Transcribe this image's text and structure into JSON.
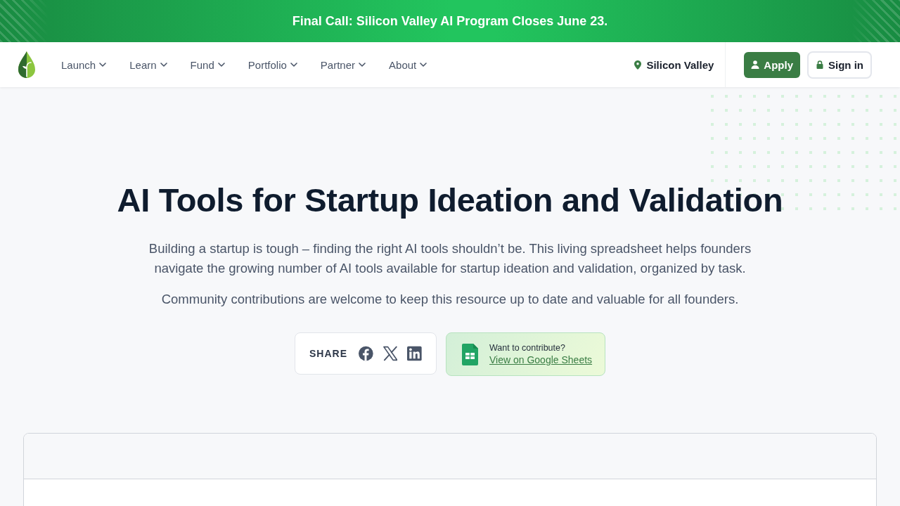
{
  "announcement_bar": {
    "text": "Final Call: Silicon Valley AI Program Closes June 23."
  },
  "nav": {
    "items": [
      {
        "label": "Launch"
      },
      {
        "label": "Learn"
      },
      {
        "label": "Fund"
      },
      {
        "label": "Portfolio"
      },
      {
        "label": "Partner"
      },
      {
        "label": "About"
      }
    ],
    "location": "Silicon Valley",
    "apply_button": {
      "label": "Apply"
    },
    "sign_in_button": {
      "label": "Sign in"
    }
  },
  "hero": {
    "title": "AI Tools for Startup Ideation and Validation",
    "paragraphs": [
      "Building a startup is tough – finding the right AI tools shouldn’t be. This living spreadsheet helps founders navigate the growing number of AI tools available for startup ideation and validation, organized by task.",
      "Community contributions are welcome to keep this resource up to date and valuable for all founders."
    ],
    "share": {
      "label": "SHARE"
    },
    "contribute": {
      "prompt": "Want to contribute?",
      "link": "View on Google Sheets"
    }
  }
}
